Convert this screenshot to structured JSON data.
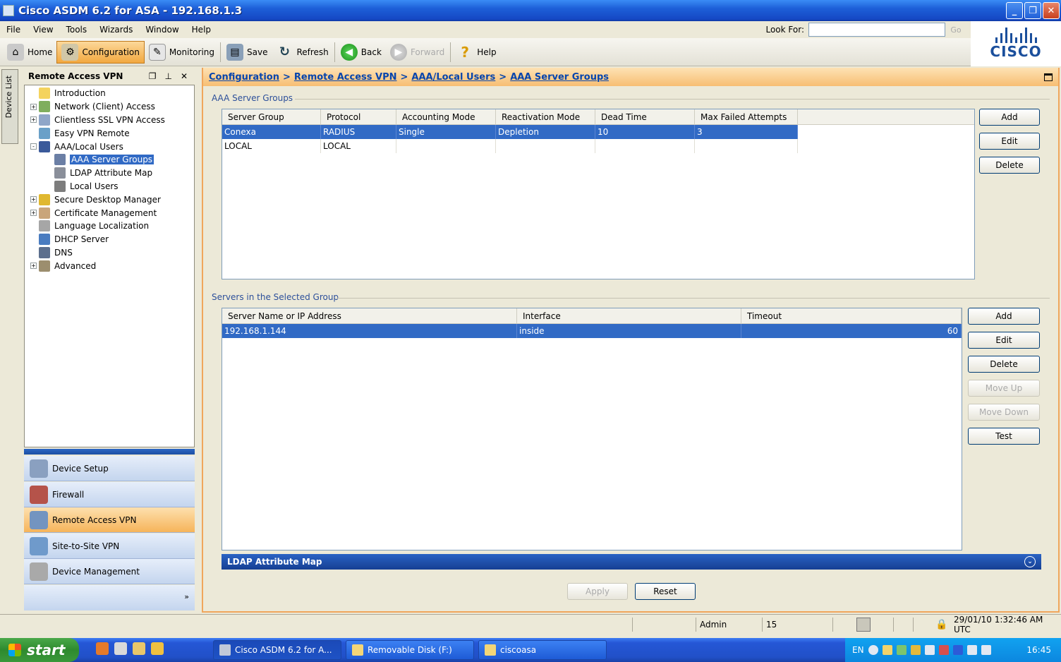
{
  "window": {
    "title": "Cisco ASDM 6.2 for ASA - 192.168.1.3"
  },
  "menu": [
    "File",
    "View",
    "Tools",
    "Wizards",
    "Window",
    "Help"
  ],
  "lookfor": {
    "label": "Look For:",
    "value": "",
    "go": "Go"
  },
  "toolbar": {
    "home": "Home",
    "configuration": "Configuration",
    "monitoring": "Monitoring",
    "save": "Save",
    "refresh": "Refresh",
    "back": "Back",
    "forward": "Forward",
    "help": "Help"
  },
  "logo": {
    "text": "CISCO"
  },
  "device_list": {
    "label": "Device List"
  },
  "left_panel": {
    "title": "Remote Access VPN",
    "tree": [
      {
        "label": "Introduction",
        "expander": ""
      },
      {
        "label": "Network (Client) Access",
        "expander": "+"
      },
      {
        "label": "Clientless SSL VPN Access",
        "expander": "+"
      },
      {
        "label": "Easy VPN Remote",
        "expander": ""
      },
      {
        "label": "AAA/Local Users",
        "expander": "-"
      },
      {
        "label": "AAA Server Groups",
        "expander": ""
      },
      {
        "label": "LDAP Attribute Map",
        "expander": ""
      },
      {
        "label": "Local Users",
        "expander": ""
      },
      {
        "label": "Secure Desktop Manager",
        "expander": "+"
      },
      {
        "label": "Certificate Management",
        "expander": "+"
      },
      {
        "label": "Language Localization",
        "expander": ""
      },
      {
        "label": "DHCP Server",
        "expander": ""
      },
      {
        "label": "DNS",
        "expander": ""
      },
      {
        "label": "Advanced",
        "expander": "+"
      }
    ],
    "nav": [
      "Device Setup",
      "Firewall",
      "Remote Access VPN",
      "Site-to-Site VPN",
      "Device Management"
    ],
    "more": "»"
  },
  "breadcrumb": {
    "items": [
      "Configuration",
      "Remote Access VPN",
      "AAA/Local Users",
      "AAA Server Groups"
    ],
    "separator": ">"
  },
  "server_groups": {
    "title": "AAA Server Groups",
    "columns": [
      "Server Group",
      "Protocol",
      "Accounting Mode",
      "Reactivation Mode",
      "Dead Time",
      "Max Failed Attempts"
    ],
    "rows": [
      [
        "Conexa",
        "RADIUS",
        "Single",
        "Depletion",
        "10",
        "3"
      ],
      [
        "LOCAL",
        "LOCAL",
        "",
        "",
        "",
        ""
      ]
    ],
    "buttons": {
      "add": "Add",
      "edit": "Edit",
      "delete": "Delete"
    }
  },
  "servers": {
    "title": "Servers in the Selected Group",
    "columns": [
      "Server Name or IP Address",
      "Interface",
      "Timeout"
    ],
    "rows": [
      [
        "192.168.1.144",
        "inside",
        "60"
      ]
    ],
    "buttons": {
      "add": "Add",
      "edit": "Edit",
      "delete": "Delete",
      "move_up": "Move Up",
      "move_down": "Move Down",
      "test": "Test"
    }
  },
  "ldap_bar": {
    "title": "LDAP Attribute Map"
  },
  "actions": {
    "apply": "Apply",
    "reset": "Reset"
  },
  "status": {
    "user": "Admin",
    "privilege": "15",
    "datetime": "29/01/10 1:32:46 AM UTC"
  },
  "taskbar": {
    "start": "start",
    "items": [
      "Cisco ASDM 6.2 for A...",
      "Removable Disk (F:)",
      "ciscoasa"
    ],
    "lang": "EN",
    "clock": "16:45"
  }
}
